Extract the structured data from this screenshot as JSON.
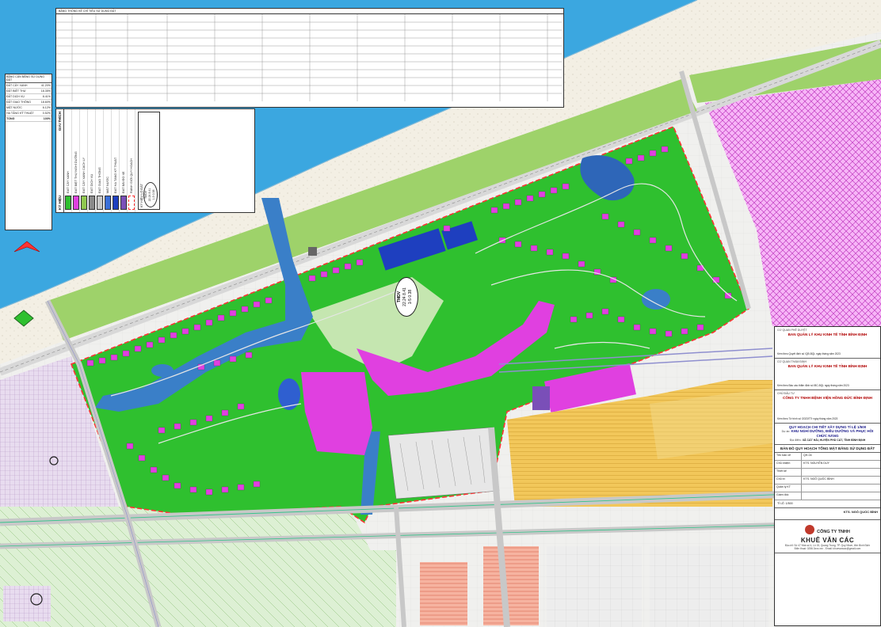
{
  "title_block": {
    "approval_agency_label": "CƠ QUAN PHÊ DUYỆT",
    "approval_agency": "BAN QUẢN LÝ KHU KINH TẾ TỈNH BÌNH ĐỊNH",
    "approval_note": "Kèm theo Quyết định số  /QĐ-BQL ngày  tháng  năm 2023",
    "appraisal_agency_label": "CƠ QUAN THẨM ĐỊNH",
    "appraisal_agency": "BAN QUẢN LÝ KHU KINH TẾ TỈNH BÌNH ĐỊNH",
    "appraisal_note": "Kèm theo Báo cáo thẩm định số  /BC-BQL ngày  tháng  năm 2023",
    "investor_label": "CHỦ ĐẦU TƯ",
    "investor": "CÔNG TY TNHH BỆNH VIỆN HỒNG ĐỨC BÌNH ĐỊNH",
    "investor_note": "Kèm theo Tờ trình số  /2023/TTr ngày  tháng  năm 2023",
    "project_heading": "QUY HOẠCH CHI TIẾT XÂY DỰNG TỈ LỆ 1/500",
    "project_label": "Dự án:",
    "project_name": "KHU NGHỈ DƯỠNG, ĐIỀU DƯỠNG VÀ PHỤC HỒI CHỨC NĂNG",
    "location_label": "Địa điểm:",
    "location": "XÃ CÁT HẢI, HUYỆN PHÙ CÁT, TỈNH BÌNH ĐỊNH",
    "drawing_title": "BẢN ĐỒ QUY HOẠCH TỔNG MẶT BẰNG SỬ DỤNG ĐẤT",
    "sheet_rows": [
      {
        "k": "Tên bản vẽ",
        "v": "QH-04"
      },
      {
        "k": "Chủ nhiệm",
        "v": "KTS. NGUYỄN DUY"
      },
      {
        "k": "Thiết kế",
        "v": ""
      },
      {
        "k": "Chủ trì",
        "v": "KTS. NGÔ QUỐC BÌNH"
      },
      {
        "k": "Quản lý KT",
        "v": ""
      },
      {
        "k": "Giám đốc",
        "v": ""
      }
    ],
    "scale": "TỈ LỆ: 1/500",
    "director": "KTS. NGÔ QUỐC BÌNH",
    "company_line1": "CÔNG TY TNHH",
    "company_line2": "KHUÊ VĂN CÁC",
    "company_address": "Địa chỉ: Số 47 Nhà số 4, Lô 15, Quang Trung, TP. Quy Nhơn, tỉnh Bình Định",
    "company_contact": "Điện thoại: 0256.3xxx.xxx - Email: khuevancac@gmail.com"
  },
  "legend": {
    "title": "KÝ HIỆU",
    "title2": "GIẢI THÍCH",
    "items": [
      {
        "label": "ĐẤT CÂY XANH",
        "color": "#2fc02f"
      },
      {
        "label": "ĐẤT BIỆT THỰ NGHỈ DƯỠNG",
        "color": "#e040e0"
      },
      {
        "label": "ĐẤT CÂY XANH CÁCH LY",
        "color": "#90c850"
      },
      {
        "label": "ĐẤT DỊCH VỤ",
        "color": "#8a8a8a"
      },
      {
        "label": "ĐẤT GIAO THÔNG",
        "color": "#c8c8c8"
      },
      {
        "label": "MẶT NƯỚC",
        "color": "#3a6fd8"
      },
      {
        "label": "ĐẤT HẠ TẦNG KỸ THUẬT",
        "color": "#1e3fbf"
      },
      {
        "label": "ĐẤT BÃI ĐỖ XE",
        "color": "#7a4fb8"
      },
      {
        "label": "RANH GIỚI QUY HOẠCH",
        "color": "#ff3333"
      }
    ],
    "symbol_note": "KÝ HIỆU LÔ ĐẤT",
    "symbol_code": "TMDV",
    "symbol_area": "22.24",
    "symbol_density": "8.41",
    "symbol_floors": "1-5",
    "symbol_coef": "0.38"
  },
  "area_table": {
    "title": "BẢNG CÂN BẰNG SỬ DỤNG ĐẤT",
    "rows": [
      {
        "name": "ĐẤT CÂY XANH",
        "value": "41.20%"
      },
      {
        "name": "ĐẤT BIỆT THỰ",
        "value": "18.35%"
      },
      {
        "name": "ĐẤT DỊCH VỤ",
        "value": "8.41%"
      },
      {
        "name": "ĐẤT GIAO THÔNG",
        "value": "18.60%"
      },
      {
        "name": "MẶT NƯỚC",
        "value": "6.12%"
      },
      {
        "name": "HẠ TẦNG KỸ THUẬT",
        "value": "0.52%"
      },
      {
        "name": "TỔNG",
        "value": "100%"
      }
    ]
  },
  "big_table": {
    "title": "BẢNG THỐNG KÊ CHỈ TIÊU SỬ DỤNG ĐẤT"
  },
  "zone_label": {
    "code": "TMDV",
    "line2": "22.24 8.41",
    "line3": "1-5 0.38"
  },
  "colors": {
    "sea": "#3ba7e0",
    "beach": "#f2efe6",
    "green": "#2fc02f",
    "buffer_green": "#90c850",
    "villa": "#e040e0",
    "pink_zone": "#f08ef0",
    "yellow_zone": "#e8b84a",
    "salmon_zone": "#f3a890",
    "water": "#2e66b8",
    "boundary": "#ff3333"
  }
}
